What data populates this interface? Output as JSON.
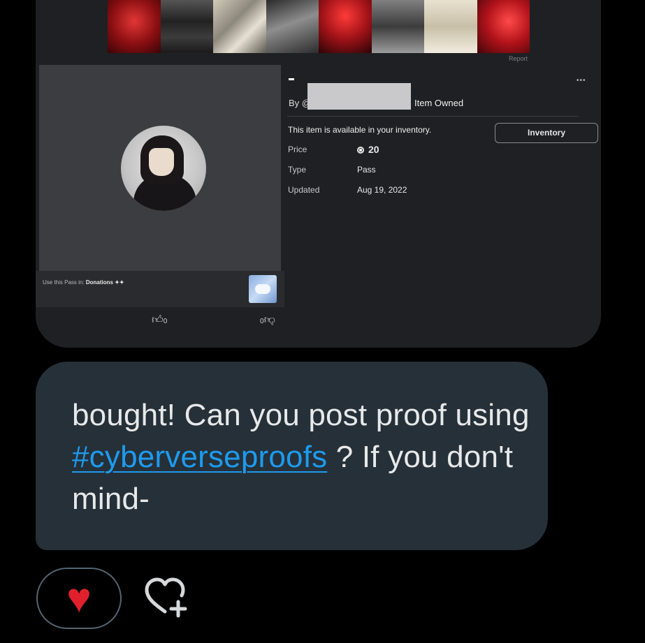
{
  "item_screenshot": {
    "report_link": "Report",
    "title": "-",
    "by_prefix": "By @",
    "ownership_status": "Item Owned",
    "availability_text": "This item is available in your inventory.",
    "inventory_button": "Inventory",
    "details": [
      {
        "label": "Price",
        "value": "20",
        "currency_icon": "robux-icon"
      },
      {
        "label": "Type",
        "value": "Pass"
      },
      {
        "label": "Updated",
        "value": "Aug 19, 2022"
      }
    ],
    "use_pass_label": "Use this Pass in:",
    "use_pass_game": "Donations ✦✦",
    "likes_count": "0",
    "dislikes_count": "0"
  },
  "message": {
    "text_before": "bought! Can you post proof using ",
    "hashtag": "#cyberverseproofs",
    "text_after": " ? If you don't mind-"
  },
  "reactions": {
    "current_reaction": "red-heart",
    "add_reaction_icon": "heart-plus-icon"
  },
  "colors": {
    "bubble_bg": "#263038",
    "hashtag": "#1d9bf0",
    "heart": "#e0202c"
  }
}
